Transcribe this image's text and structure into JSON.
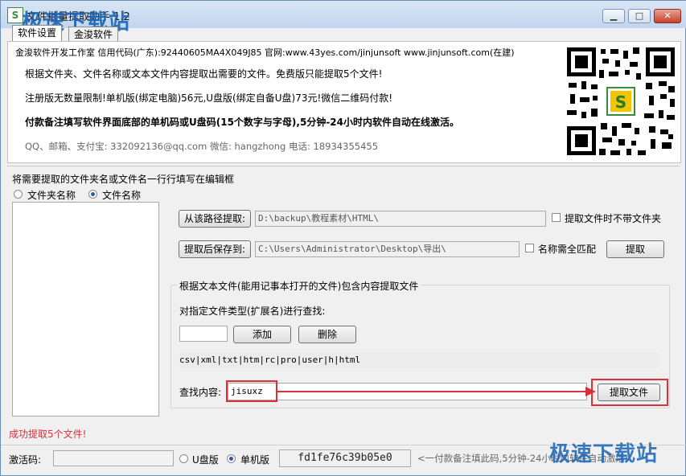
{
  "window": {
    "title": "文件批量提取助手 1.2",
    "watermark_top": "极速下载站",
    "watermark_bottom": "极速下载站",
    "min_glyph": "▁",
    "max_glyph": "□",
    "close_glyph": "✕",
    "icon_glyph": "S"
  },
  "tabs": [
    {
      "label": "软件设置"
    },
    {
      "label": "金浚软件"
    }
  ],
  "info": {
    "line1": "金浚软件开发工作室 信用代码(广东):92440605MA4X049J85 官网:www.43yes.com/jinjunsoft  www.jinjunsoft.com(在建)",
    "line2": "根据文件夹、文件名称或文本文件内容提取出需要的文件。免费版只能提取5个文件!",
    "line3": "注册版无数量限制!单机版(绑定电脑)56元,U盘版(绑定自备U盘)73元!微信二维码付款!",
    "line4": "付款备注填写软件界面底部的单机码或U盘码(15个数字与字母),5分钟-24小时内软件自动在线激活。",
    "line5": "QQ、邮箱、支付宝: 332092136@qq.com   微信: hangzhong   电话: 18934355455"
  },
  "section": {
    "heading": "将需要提取的文件夹名或文件名一行行填写在编辑框",
    "radio_folder": "文件夹名称",
    "radio_file": "文件名称",
    "selected": "文件名称"
  },
  "path": {
    "from_button": "从该路径提取:",
    "from_value": "D:\\backup\\教程素材\\HTML\\",
    "no_folder_label": "提取文件时不带文件夹",
    "save_button": "提取后保存到:",
    "save_value": "C:\\Users\\Administrator\\Desktop\\导出\\",
    "exact_match_label": "名称需全匹配",
    "extract_button": "提取"
  },
  "content_group": {
    "title": "根据文本文件(能用记事本打开的文件)包含内容提取文件",
    "ext_label": "对指定文件类型(扩展名)进行查找:",
    "ext_input": "",
    "add_button": "添加",
    "delete_button": "删除",
    "ext_list": "csv|xml|txt|htm|rc|pro|user|h|html",
    "search_label": "查找内容:",
    "search_value": "jisuxz",
    "extract_files_button": "提取文件"
  },
  "status": {
    "message": "成功提取5个文件!",
    "color": "#d9303a"
  },
  "footer": {
    "activation_label": "激活码:",
    "activation_value": "",
    "usb_label": "U盘版",
    "pc_label": "单机版",
    "selected": "单机版",
    "machine_code": "fd1fe76c39b05e0",
    "hint": "<一付款备注填此码,5分钟-24小时内软件自动激活!"
  },
  "colors": {
    "accent_red": "#d9303a",
    "watermark_blue": "#1b64b6"
  }
}
